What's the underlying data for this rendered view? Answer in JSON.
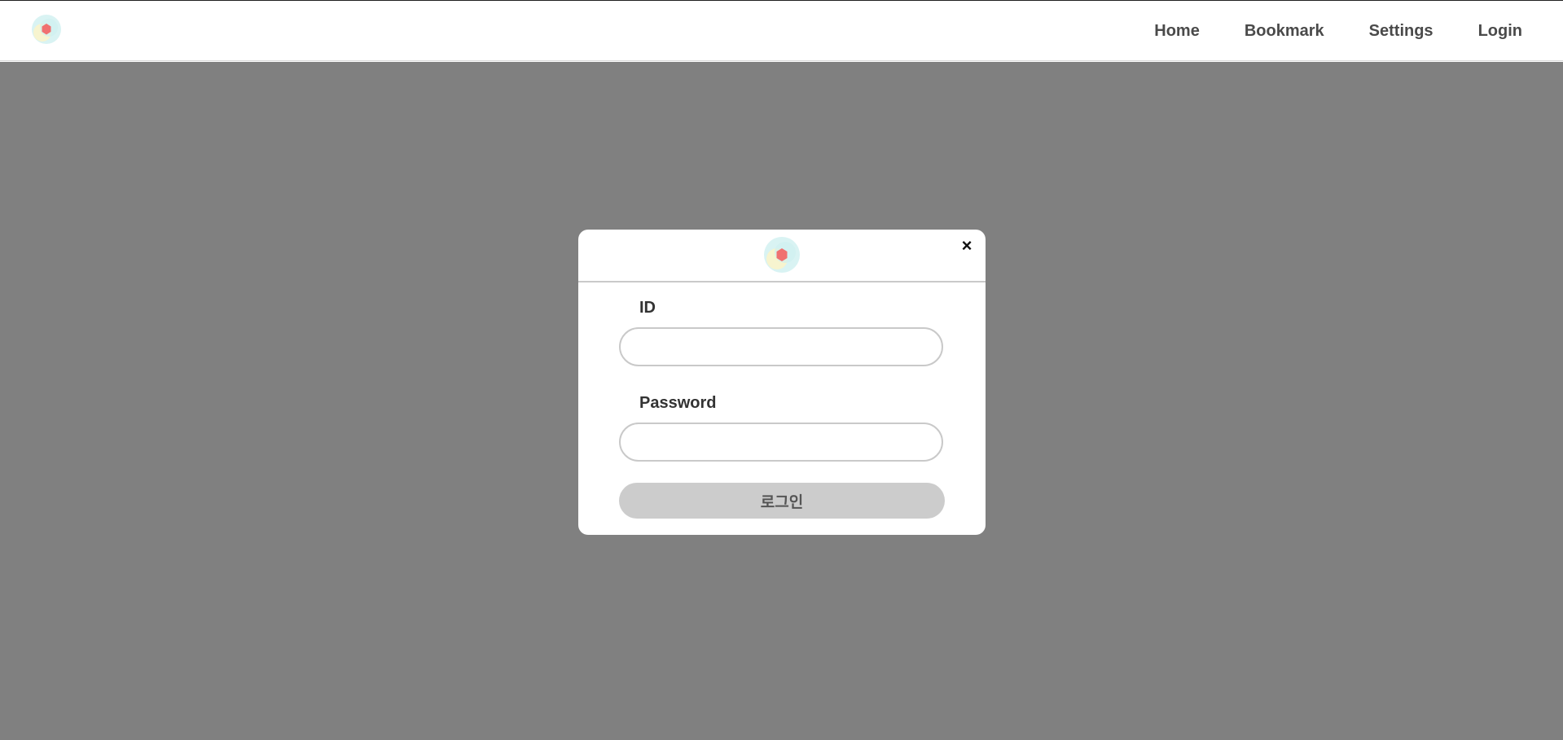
{
  "nav": {
    "items": [
      {
        "label": "Home"
      },
      {
        "label": "Bookmark"
      },
      {
        "label": "Settings"
      },
      {
        "label": "Login"
      }
    ]
  },
  "modal": {
    "close_label": "×",
    "id_label": "ID",
    "id_value": "",
    "password_label": "Password",
    "password_value": "",
    "submit_label": "로그인"
  },
  "icons": {
    "brand": "logo-icon",
    "close": "close-icon"
  },
  "colors": {
    "overlay": "#808080",
    "logo_ring": "#d9f3f3",
    "logo_yellow": "#fbf3c8",
    "logo_hex": "#f07070",
    "button_disabled": "#cccccc"
  }
}
